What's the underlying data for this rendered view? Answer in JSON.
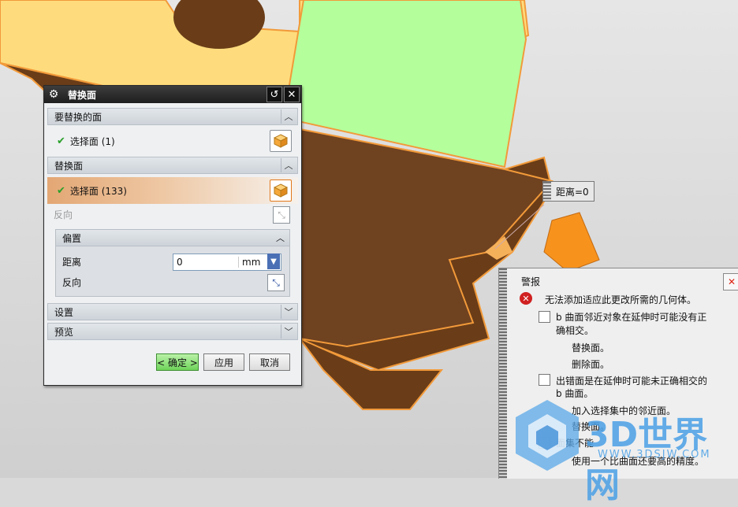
{
  "dialog": {
    "title": "替换面",
    "section1": {
      "label": "要替换的面",
      "item": "选择面 (1)"
    },
    "section2": {
      "label": "替换面",
      "item": "选择面 (133)",
      "reverse_label": "反向"
    },
    "offset_group": {
      "label": "偏置",
      "distance_label": "距离",
      "distance_value": "0",
      "unit": "mm",
      "reverse_label": "反向"
    },
    "settings_label": "设置",
    "preview_label": "预览",
    "buttons": {
      "ok": "< 确定 >",
      "apply": "应用",
      "cancel": "取消"
    }
  },
  "distance_tag": "距离=0",
  "alert": {
    "title": "警报",
    "message": "无法添加适应此更改所需的几何体。",
    "items": [
      {
        "text": "b 曲面邻近对象在延伸时可能没有正",
        "text2": "确相交。",
        "subs": [
          "替换面。",
          "删除面。"
        ]
      },
      {
        "text": "出错面是在延伸时可能未正确相交的",
        "text2": "b 曲面。",
        "subs": [
          "加入选择集中的邻近面。",
          "替换面。"
        ]
      },
      {
        "text": "面集不能",
        "subs": [
          "使用一个比曲面还要高的精度。"
        ]
      }
    ]
  },
  "watermark": {
    "brand": "3D世界网",
    "url": "WWW.3DSJW.COM"
  },
  "colors": {
    "model_yellow": "#fedc7d",
    "model_green": "#b4ff9c",
    "model_brown": "#6a3d18",
    "edge_orange": "#f29a3a",
    "ok_green": "#6fd35a"
  }
}
